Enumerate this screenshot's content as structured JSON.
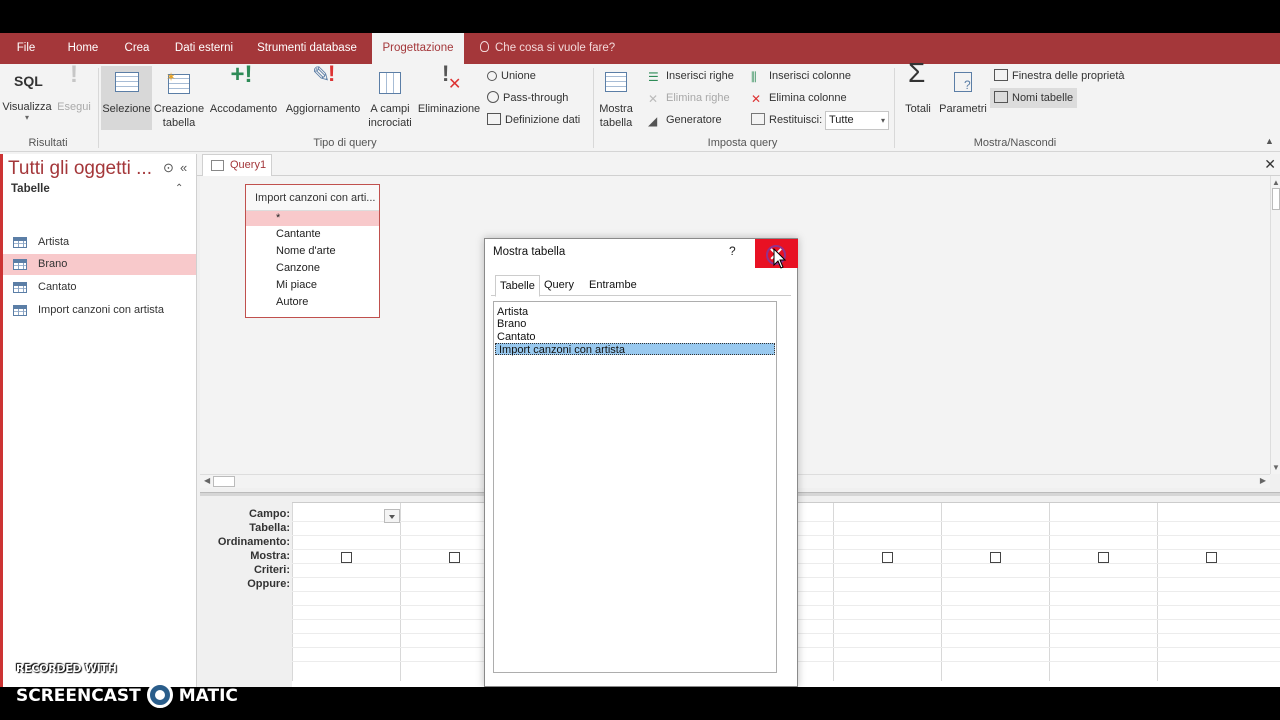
{
  "ribbon_tabs": [
    "File",
    "Home",
    "Crea",
    "Dati esterni",
    "Strumenti database",
    "Progettazione"
  ],
  "tell_me": "Che cosa si vuole fare?",
  "ribbon": {
    "risultati": {
      "label": "Risultati",
      "visualizza": "Visualizza",
      "esegui": "Esegui",
      "sql": "SQL"
    },
    "tipo_query": {
      "label": "Tipo di query",
      "selezione": "Selezione",
      "creazione_tabella_1": "Creazione",
      "creazione_tabella_2": "tabella",
      "accodamento": "Accodamento",
      "aggiornamento": "Aggiornamento",
      "campi_incrociati_1": "A campi",
      "campi_incrociati_2": "incrociati",
      "eliminazione": "Eliminazione",
      "unione": "Unione",
      "pass_through": "Pass-through",
      "definizione_dati": "Definizione dati"
    },
    "imposta_query": {
      "label": "Imposta query",
      "mostra_tabella_1": "Mostra",
      "mostra_tabella_2": "tabella",
      "inserisci_righe": "Inserisci righe",
      "elimina_righe": "Elimina righe",
      "generatore": "Generatore",
      "inserisci_colonne": "Inserisci colonne",
      "elimina_colonne": "Elimina colonne",
      "restituisci": "Restituisci:",
      "restituisci_value": "Tutte"
    },
    "mostra_nascondi": {
      "label": "Mostra/Nascondi",
      "totali": "Totali",
      "parametri": "Parametri",
      "finestra_proprieta": "Finestra delle proprietà",
      "nomi_tabelle": "Nomi tabelle"
    }
  },
  "nav": {
    "title": "Tutti gli oggetti ...",
    "section": "Tabelle",
    "items": [
      "Artista",
      "Brano",
      "Cantato",
      "Import canzoni con artista"
    ]
  },
  "document": {
    "tab": "Query1",
    "field_list": {
      "title": "Import canzoni con arti...",
      "star": "*",
      "fields": [
        "Cantante",
        "Nome d'arte",
        "Canzone",
        "Mi piace",
        "Autore"
      ]
    },
    "grid_labels": [
      "Campo:",
      "Tabella:",
      "Ordinamento:",
      "Mostra:",
      "Criteri:",
      "Oppure:"
    ]
  },
  "dialog": {
    "title": "Mostra tabella",
    "help": "?",
    "tabs": [
      "Tabelle",
      "Query",
      "Entrambe"
    ],
    "items": [
      "Artista",
      "Brano",
      "Cantato",
      "Import canzoni con artista"
    ]
  },
  "watermark": {
    "line1": "RECORDED WITH",
    "line2a": "SCREENCAST",
    "line2b": "MATIC"
  }
}
